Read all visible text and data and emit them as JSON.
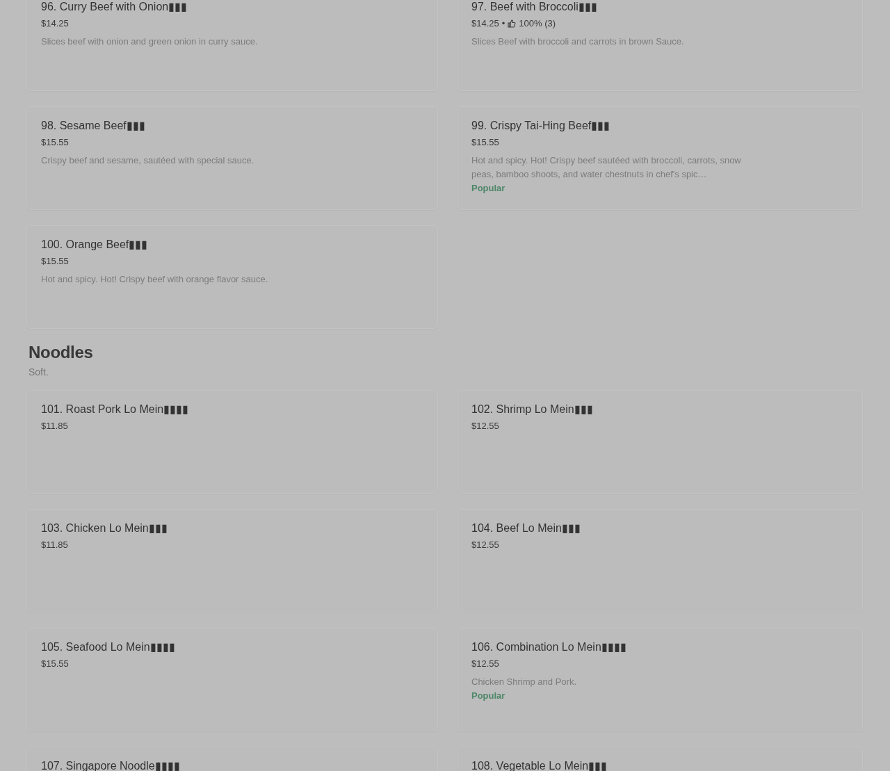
{
  "sections": [
    {
      "items": [
        {
          "title": "96. Curry Beef with Onion▮▮▮",
          "price": "$14.25",
          "description": "Slices beef with onion and green onion in curry sauce."
        },
        {
          "title": "97. Beef with Broccoli▮▮▮",
          "price": "$14.25",
          "separator": "•",
          "rating": "100% (3)",
          "description": "Slices Beef with broccoli and carrots in brown Sauce."
        },
        {
          "title": "98. Sesame Beef▮▮▮",
          "price": "$15.55",
          "description": "Crispy beef and sesame, sautéed with special sauce."
        },
        {
          "title": "99. Crispy Tai-Hing Beef▮▮▮",
          "price": "$15.55",
          "description": "Hot and spicy. Hot! Crispy beef sautéed with broccoli, carrots, snow peas, bamboo shoots, and water chestnuts in chef's spic…",
          "badge": "Popular"
        },
        {
          "title": "100. Orange Beef▮▮▮",
          "price": "$15.55",
          "description": "Hot and spicy. Hot! Crispy beef with orange flavor sauce."
        }
      ]
    },
    {
      "heading": "Noodles",
      "subheading": "Soft.",
      "items": [
        {
          "title": "101. Roast Pork Lo Mein▮▮▮▮",
          "price": "$11.85"
        },
        {
          "title": "102. Shrimp Lo Mein▮▮▮",
          "price": "$12.55"
        },
        {
          "title": "103. Chicken Lo Mein▮▮▮",
          "price": "$11.85"
        },
        {
          "title": "104. Beef Lo Mein▮▮▮",
          "price": "$12.55"
        },
        {
          "title": "105. Seafood Lo Mein▮▮▮▮",
          "price": "$15.55"
        },
        {
          "title": "106. Combination Lo Mein▮▮▮▮",
          "price": "$12.55",
          "description": "Chicken Shrimp and Pork.",
          "badge": "Popular"
        },
        {
          "title": "107. Singapore Noodle▮▮▮▮"
        },
        {
          "title": "108. Vegetable Lo Mein▮▮▮"
        }
      ]
    }
  ]
}
